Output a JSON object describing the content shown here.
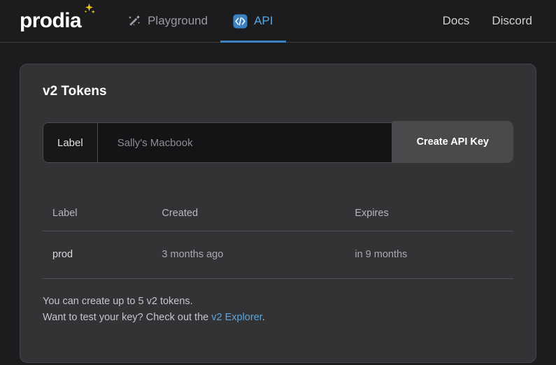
{
  "brand": {
    "name": "prodia",
    "sparkle_icon": "sparkle-icon"
  },
  "nav": {
    "tabs": [
      {
        "label": "Playground",
        "icon": "magic-wand-icon",
        "active": false
      },
      {
        "label": "API",
        "icon": "code-brackets-icon",
        "active": true
      }
    ],
    "links": [
      {
        "label": "Docs"
      },
      {
        "label": "Discord"
      }
    ]
  },
  "card": {
    "title": "v2 Tokens",
    "form": {
      "prefix_label": "Label",
      "input_value": "",
      "input_placeholder": "Sally's Macbook",
      "submit_label": "Create API Key"
    },
    "table": {
      "columns": [
        "Label",
        "Created",
        "Expires"
      ],
      "rows": [
        {
          "label": "prod",
          "created": "3 months ago",
          "expires": "in 9 months"
        }
      ]
    },
    "notes": {
      "line1": "You can create up to 5 v2 tokens.",
      "line2_before": "Want to test your key? Check out the ",
      "line2_link": "v2 Explorer",
      "line2_after": "."
    }
  },
  "colors": {
    "page_bg": "#1c1c1e",
    "card_bg": "#333336",
    "accent": "#3b82c4",
    "link": "#5ba4dc",
    "button_bg": "#4a4a4d"
  }
}
